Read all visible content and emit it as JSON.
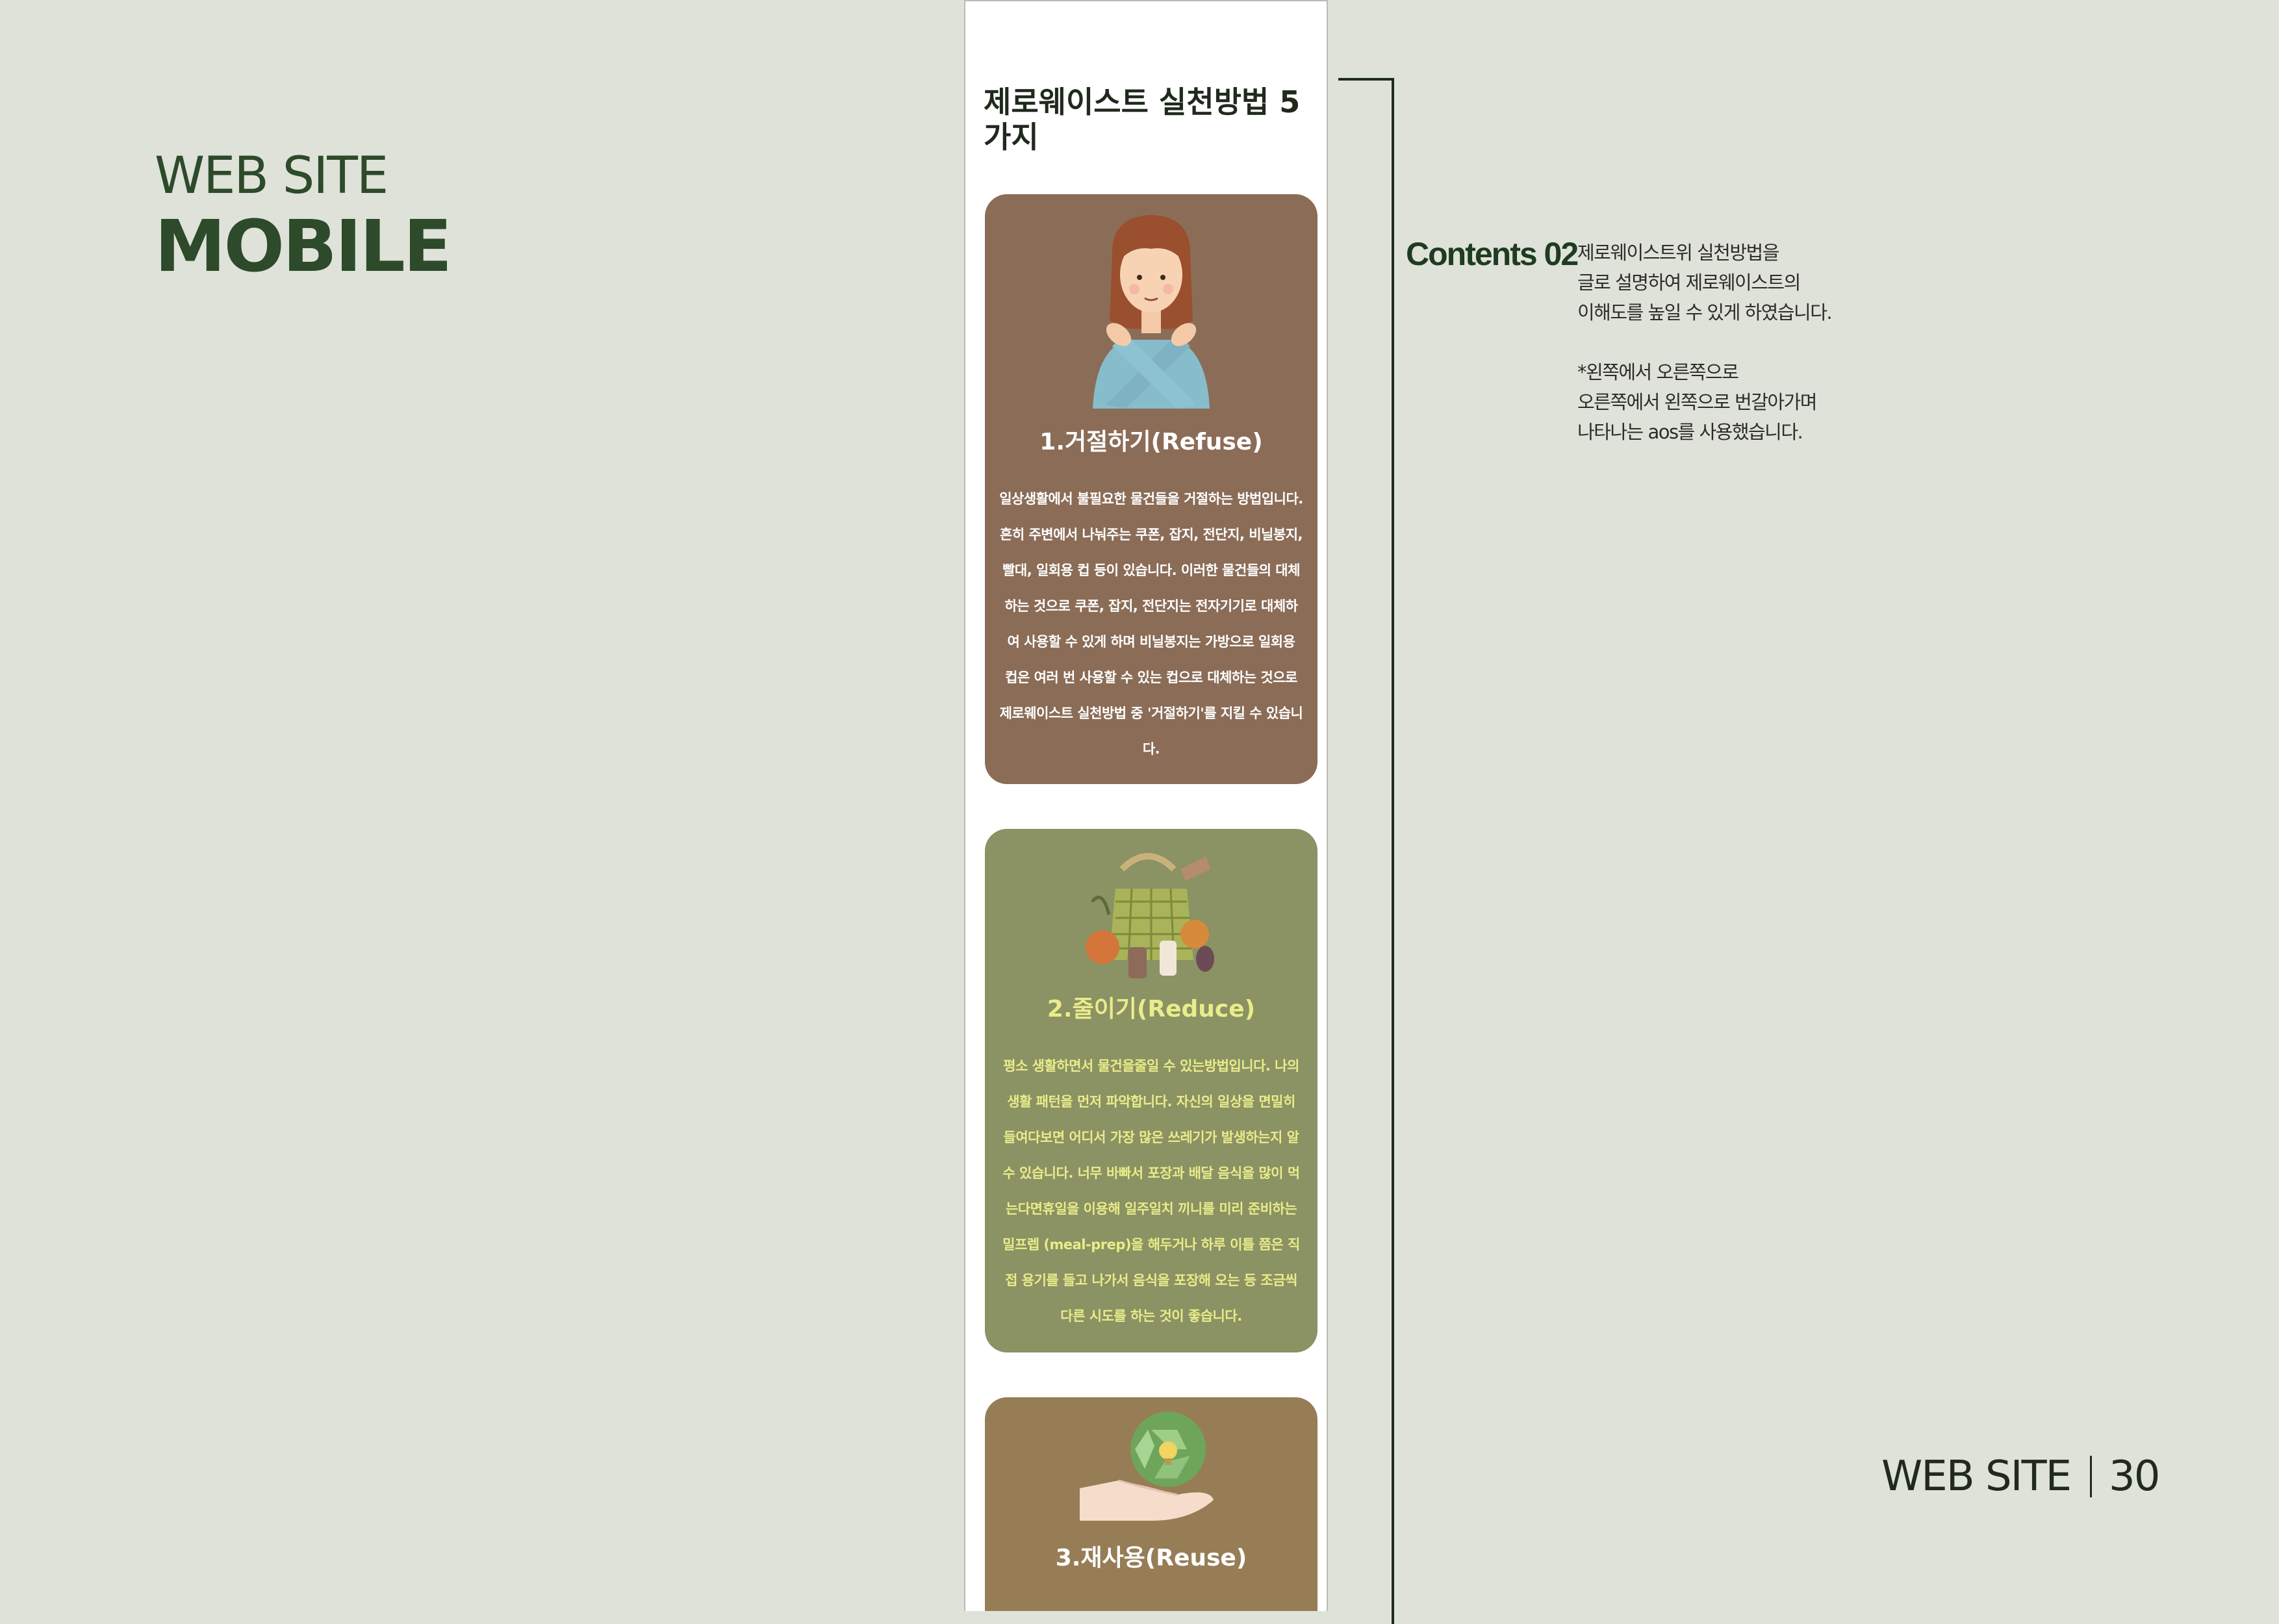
{
  "heading": {
    "subtitle": "WEB SITE",
    "title": "MOBILE"
  },
  "mobile": {
    "page_title": "제로웨이스트 실천방법 5가지",
    "cards": [
      {
        "title": "1.거절하기(Refuse)",
        "body": "일상생활에서 불필요한 물건들을 거절하는 방법입니다. 흔히 주변에서 나눠주는 쿠폰, 잡지, 전단지, 비닐봉지, 빨대, 일회용 컵 등이 있습니다. 이러한 물건들의 대체하는 것으로 쿠폰, 잡지, 전단지는 전자기기로 대체하여 사용할 수 있게 하며 비닐봉지는 가방으로 일회용 컵은 여러 번 사용할 수 있는 컵으로 대체하는 것으로 제로웨이스트 실천방법 중 '거절하기'를 지킬 수 있습니다.",
        "illustration": "woman-crossed-arms-illustration"
      },
      {
        "title": "2.줄이기(Reduce)",
        "body": "평소 생활하면서 물건을줄일 수 있는방법입니다. 나의 생활 패턴을 먼저 파악합니다. 자신의 일상을 면밀히 들여다보면 어디서 가장 많은 쓰레기가 발생하는지 알 수 있습니다. 너무 바빠서 포장과 배달 음식을 많이 먹는다면휴일을 이용해 일주일치 끼니를 미리 준비하는 밀프렙 (meal-prep)을 해두거나 하루 이틀 쯤은 직접 용기를 들고 나가서 음식을 포장해 오는 등 조금씩 다른 시도를 하는 것이 좋습니다.",
        "illustration": "reusable-bag-illustration"
      },
      {
        "title": "3.재사용(Reuse)",
        "illustration": "recycle-hand-illustration"
      }
    ]
  },
  "description": {
    "label": "Contents 02",
    "lines": [
      "제로웨이스트위 실천방법을",
      "글로 설명하여 제로웨이스트의",
      "이해도를 높일 수 있게 하였습니다.",
      "",
      "*왼쪽에서 오른쪽으로",
      "오른쪽에서 왼쪽으로 번갈아가며",
      "나타나는 aos를 사용했습니다."
    ]
  },
  "footer": {
    "section": "WEB SITE",
    "page_number": "30"
  },
  "colors": {
    "background": "#dfe2d8",
    "heading": "#2d4a2b",
    "card_1": "#8b6c57",
    "card_2": "#8b9263",
    "card_3": "#967d56",
    "card_2_text": "#e9ec8a"
  }
}
